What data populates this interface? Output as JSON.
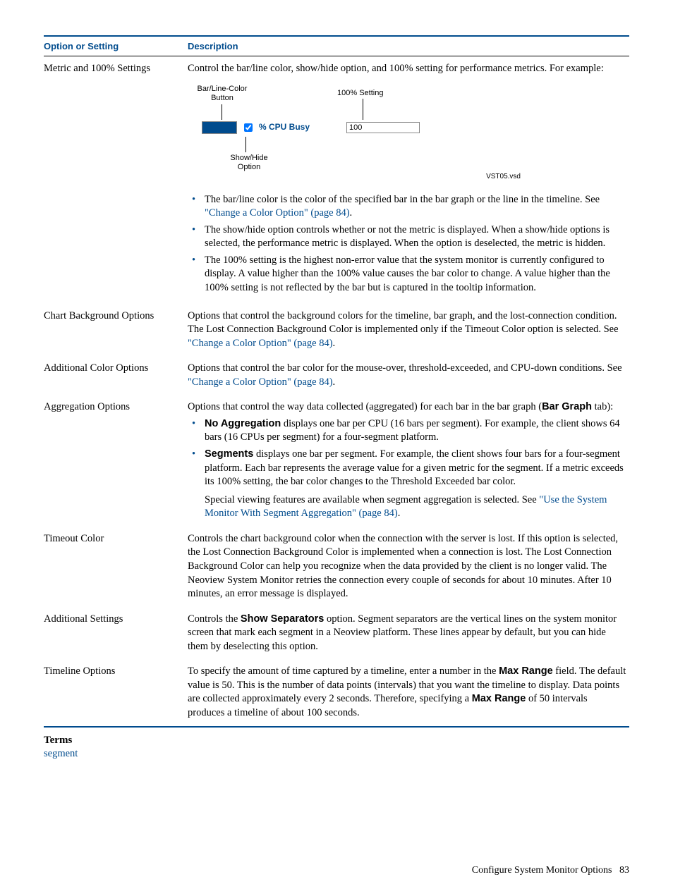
{
  "table": {
    "header_option": "Option or Setting",
    "header_desc": "Description",
    "rows": {
      "metric": {
        "option": "Metric and 100% Settings",
        "intro": "Control the bar/line color, show/hide option, and 100% setting for performance metrics. For example:",
        "diagram": {
          "lbl_color": "Bar/Line-Color Button",
          "lbl_setting": "100% Setting",
          "lbl_showhide": "Show/Hide Option",
          "metric_label": "% CPU Busy",
          "metric_value": "100",
          "source": "VST05.vsd"
        },
        "bullets": {
          "b1a": "The bar/line color is the color of the specified bar in the bar graph or the line in the timeline. See ",
          "b1_link": "\"Change a Color Option\" (page 84)",
          "b1b": ".",
          "b2": "The show/hide option controls whether or not the metric is displayed. When a show/hide options is selected, the performance metric is displayed. When the option is deselected, the metric is hidden.",
          "b3": "The 100% setting is the highest non-error value that the system monitor is currently configured to display. A value higher than the 100% value causes the bar color to change. A value higher than the 100% setting is not reflected by the bar but is captured in the tooltip information."
        }
      },
      "chartbg": {
        "option": "Chart Background Options",
        "desc1": "Options that control the background colors for the timeline, bar graph, and the lost-connection condition. The Lost Connection Background Color is implemented only if the Timeout Color option is selected. See ",
        "link": "\"Change a Color Option\" (page 84)",
        "desc2": "."
      },
      "addcolor": {
        "option": "Additional Color Options",
        "desc1": "Options that control the bar color for the mouse-over, threshold-exceeded, and CPU-down conditions. See ",
        "link": "\"Change a Color Option\" (page 84)",
        "desc2": "."
      },
      "agg": {
        "option": "Aggregation Options",
        "intro1": "Options that control the way data collected (aggregated) for each bar in the bar graph (",
        "intro_bold": "Bar Graph",
        "intro2": " tab):",
        "b1_bold": "No Aggregation",
        "b1_rest": " displays one bar per CPU (16 bars per segment). For example, the client shows 64 bars (16 CPUs per segment) for a four-segment platform.",
        "b2_bold": "Segments",
        "b2_rest": " displays one bar per segment. For example, the client shows four bars for a four-segment platform. Each bar represents the average value for a given metric for the segment. If a metric exceeds its 100% setting, the bar color changes to the Threshold Exceeded bar color.",
        "tail1": "Special viewing features are available when segment aggregation is selected. See ",
        "tail_link": "\"Use the System Monitor With Segment Aggregation\" (page 84)",
        "tail2": "."
      },
      "timeout": {
        "option": "Timeout Color",
        "desc": "Controls the chart background color when the connection with the server is lost. If this option is selected, the Lost Connection Background Color is implemented when a connection is lost. The Lost Connection Background Color can help you recognize when the data provided by the client is no longer valid. The Neoview System Monitor retries the connection every couple of seconds for about 10 minutes. After 10 minutes, an error message is displayed."
      },
      "addset": {
        "option": "Additional Settings",
        "d1": "Controls the ",
        "d_bold": "Show Separators",
        "d2": " option. Segment separators are the vertical lines on the system monitor screen that mark each segment in a Neoview platform. These lines appear by default, but you can hide them by deselecting this option."
      },
      "timeline": {
        "option": "Timeline Options",
        "d1": "To specify the amount of time captured by a timeline, enter a number in the ",
        "d_bold1": "Max Range",
        "d2": " field. The default value is 50. This is the number of data points (intervals) that you want the timeline to display. Data points are collected approximately every 2 seconds. Therefore, specifying a ",
        "d_bold2": "Max Range",
        "d3": " of 50 intervals produces a timeline of about 100 seconds."
      }
    }
  },
  "terms": {
    "heading": "Terms",
    "link": "segment"
  },
  "footer": {
    "title": "Configure System Monitor Options",
    "page": "83"
  }
}
